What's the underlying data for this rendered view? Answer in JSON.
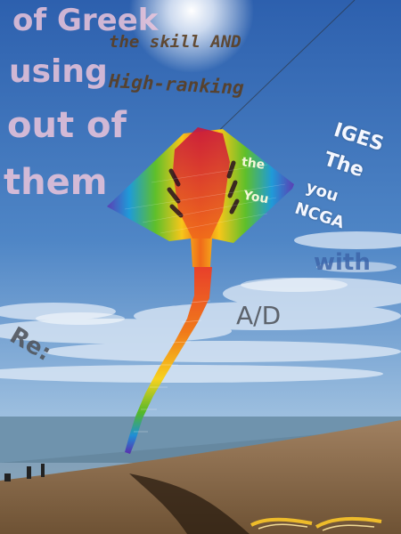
{
  "overlay_text": {
    "pink_lines": [
      "of Greek",
      "using",
      "out of",
      "them"
    ],
    "brown_lines": [
      "the skill AND",
      "High-ranking"
    ],
    "kite_words": [
      "the",
      "You"
    ],
    "white_lines": [
      "IGES",
      "The",
      "you",
      "NCGA"
    ],
    "blue_word": "with",
    "grey_label": "A/D",
    "re_label": "Re:"
  },
  "colors": {
    "sky_top": "#2e62b0",
    "sky_bottom": "#c7d8ea",
    "sea": "#6f93ad",
    "sand": "#8a6a45",
    "kite_palette": [
      "#d21f45",
      "#f06a1a",
      "#f7c61a",
      "#5fbf2a",
      "#1f9bd8",
      "#6b3fb6"
    ]
  }
}
